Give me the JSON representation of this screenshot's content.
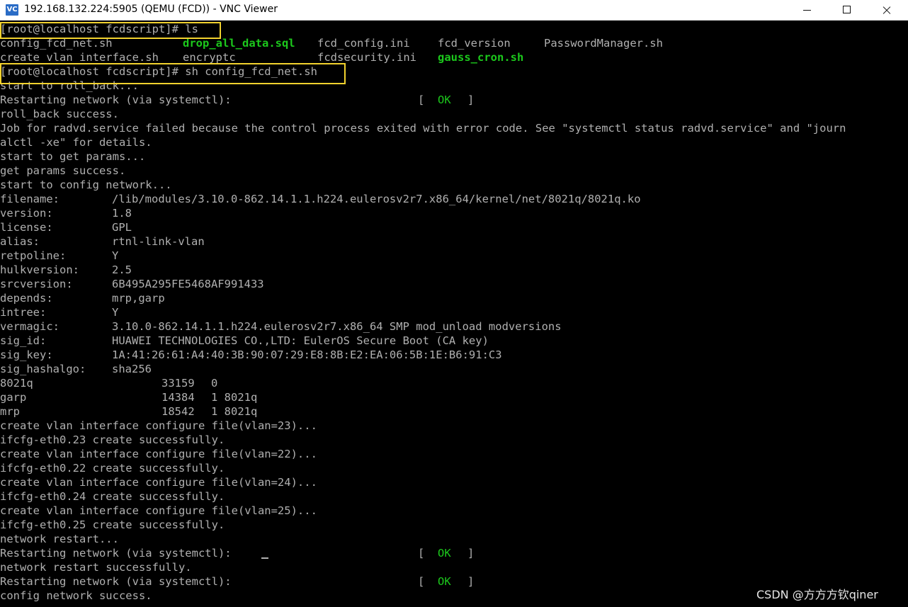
{
  "window": {
    "app_icon_text": "VC",
    "title": "192.168.132.224:5905 (QEMU (FCD)) - VNC Viewer"
  },
  "colors": {
    "background": "#000000",
    "text": "#b0b0b0",
    "executable": "#1cc81c",
    "status_ok": "#1cc81c",
    "highlight_box": "#f2d22e"
  },
  "terminal": {
    "lines": [
      {
        "segments": [
          {
            "text": "[root@localhost fcdscript]# ls"
          }
        ]
      },
      {
        "segments": [
          {
            "text": "config_fcd_net.sh"
          },
          {
            "text": "drop_all_data.sql",
            "style": "green"
          },
          {
            "text": "fcd_config.ini"
          },
          {
            "text": "fcd_version"
          },
          {
            "text": "PasswordManager.sh"
          }
        ]
      },
      {
        "segments": [
          {
            "text": "create_vlan_interface.sh"
          },
          {
            "text": "encryptc"
          },
          {
            "text": "fcdsecurity.ini"
          },
          {
            "text": "gauss_cron.sh",
            "style": "green"
          }
        ]
      },
      {
        "segments": [
          {
            "text": "[root@localhost fcdscript]# sh config_fcd_net.sh"
          }
        ]
      },
      {
        "segments": [
          {
            "text": "start to roll_back..."
          }
        ]
      },
      {
        "segments": [
          {
            "text": "Restarting network (via systemctl):"
          },
          {
            "text": "["
          },
          {
            "text": "OK",
            "style": "ok"
          },
          {
            "text": "]"
          }
        ]
      },
      {
        "segments": [
          {
            "text": "roll_back success."
          }
        ]
      },
      {
        "segments": [
          {
            "text": "Job for radvd.service failed because the control process exited with error code. See \"systemctl status radvd.service\" and \"journ"
          }
        ]
      },
      {
        "segments": [
          {
            "text": "alctl -xe\" for details."
          }
        ]
      },
      {
        "segments": [
          {
            "text": "start to get params..."
          }
        ]
      },
      {
        "segments": [
          {
            "text": "get params success."
          }
        ]
      },
      {
        "segments": [
          {
            "text": "start to config network..."
          }
        ]
      },
      {
        "segments": [
          {
            "text": "filename:"
          },
          {
            "text": "/lib/modules/3.10.0-862.14.1.1.h224.eulerosv2r7.x86_64/kernel/net/8021q/8021q.ko"
          }
        ]
      },
      {
        "segments": [
          {
            "text": "version:"
          },
          {
            "text": "1.8"
          }
        ]
      },
      {
        "segments": [
          {
            "text": "license:"
          },
          {
            "text": "GPL"
          }
        ]
      },
      {
        "segments": [
          {
            "text": "alias:"
          },
          {
            "text": "rtnl-link-vlan"
          }
        ]
      },
      {
        "segments": [
          {
            "text": "retpoline:"
          },
          {
            "text": "Y"
          }
        ]
      },
      {
        "segments": [
          {
            "text": "hulkversion:"
          },
          {
            "text": "2.5"
          }
        ]
      },
      {
        "segments": [
          {
            "text": "srcversion:"
          },
          {
            "text": "6B495A295FE5468AF991433"
          }
        ]
      },
      {
        "segments": [
          {
            "text": "depends:"
          },
          {
            "text": "mrp,garp"
          }
        ]
      },
      {
        "segments": [
          {
            "text": "intree:"
          },
          {
            "text": "Y"
          }
        ]
      },
      {
        "segments": [
          {
            "text": "vermagic:"
          },
          {
            "text": "3.10.0-862.14.1.1.h224.eulerosv2r7.x86_64 SMP mod_unload modversions"
          }
        ]
      },
      {
        "segments": [
          {
            "text": "sig_id:"
          },
          {
            "text": "HUAWEI TECHNOLOGIES CO.,LTD: EulerOS Secure Boot (CA key)"
          }
        ]
      },
      {
        "segments": [
          {
            "text": "sig_key:"
          },
          {
            "text": "1A:41:26:61:A4:40:3B:90:07:29:E8:8B:E2:EA:06:5B:1E:B6:91:C3"
          }
        ]
      },
      {
        "segments": [
          {
            "text": "sig_hashalgo:"
          },
          {
            "text": "sha256"
          }
        ]
      },
      {
        "segments": [
          {
            "text": "8021q"
          },
          {
            "text": "33159"
          },
          {
            "text": "0"
          }
        ]
      },
      {
        "segments": [
          {
            "text": "garp"
          },
          {
            "text": "14384"
          },
          {
            "text": "1 8021q"
          }
        ]
      },
      {
        "segments": [
          {
            "text": "mrp"
          },
          {
            "text": "18542"
          },
          {
            "text": "1 8021q"
          }
        ]
      },
      {
        "segments": [
          {
            "text": "create vlan interface configure file(vlan=23)..."
          }
        ]
      },
      {
        "segments": [
          {
            "text": "ifcfg-eth0.23 create successfully."
          }
        ]
      },
      {
        "segments": [
          {
            "text": "create vlan interface configure file(vlan=22)..."
          }
        ]
      },
      {
        "segments": [
          {
            "text": "ifcfg-eth0.22 create successfully."
          }
        ]
      },
      {
        "segments": [
          {
            "text": "create vlan interface configure file(vlan=24)..."
          }
        ]
      },
      {
        "segments": [
          {
            "text": "ifcfg-eth0.24 create successfully."
          }
        ]
      },
      {
        "segments": [
          {
            "text": "create vlan interface configure file(vlan=25)..."
          }
        ]
      },
      {
        "segments": [
          {
            "text": "ifcfg-eth0.25 create successfully."
          }
        ]
      },
      {
        "segments": [
          {
            "text": "network restart..."
          }
        ]
      },
      {
        "segments": [
          {
            "text": "Restarting network (via systemctl):"
          },
          {
            "text": "["
          },
          {
            "text": "OK",
            "style": "ok"
          },
          {
            "text": "]"
          }
        ]
      },
      {
        "segments": [
          {
            "text": "network restart successfully."
          }
        ]
      },
      {
        "segments": [
          {
            "text": "Restarting network (via systemctl):"
          },
          {
            "text": "["
          },
          {
            "text": "OK",
            "style": "ok"
          },
          {
            "text": "]"
          }
        ]
      },
      {
        "segments": [
          {
            "text": "config network success."
          }
        ]
      }
    ]
  },
  "watermark": "CSDN @方方方钦qiner"
}
